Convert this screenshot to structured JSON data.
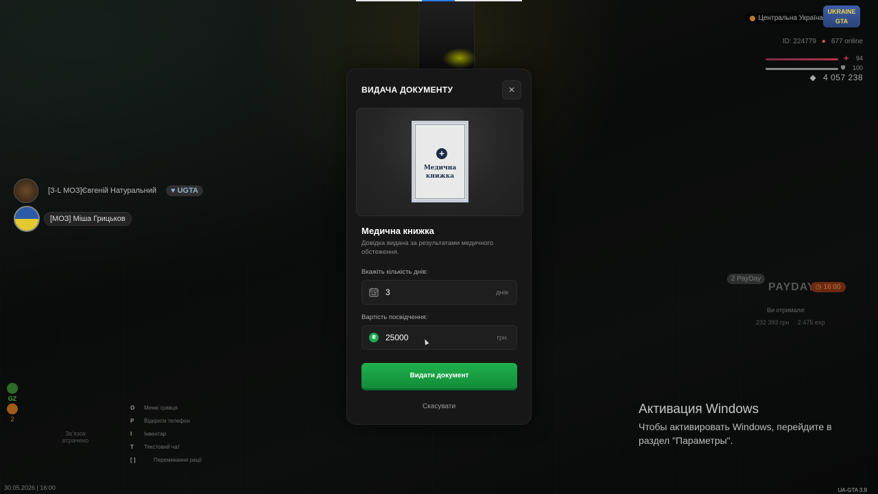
{
  "hud": {
    "region": "Центральна Україна",
    "logo": "UKRAINE GTA",
    "id_text": "ID: 224779",
    "online_text": "677 online",
    "hp": "94",
    "armor": "100",
    "money": "4 057 238"
  },
  "chat_players": [
    {
      "name": "[З-L МОЗ]Євгеній Натуральний",
      "tag": "UGTA"
    },
    {
      "name": "[МОЗ] Міша Грицьков"
    }
  ],
  "left_hud": {
    "gz": "GZ",
    "count": "2"
  },
  "keybinds": [
    {
      "key": "O",
      "label": "Меню гравця"
    },
    {
      "key": "P",
      "label": "Відкрити телефон"
    },
    {
      "key": "I",
      "label": "Інвентар"
    },
    {
      "key": "T",
      "label": "Текстовий чат"
    },
    {
      "key": "[ ]",
      "label": "Перемикання рації"
    }
  ],
  "zone_text": "Зв'язок втрачено",
  "datetime": "30.05.2026 | 16:00",
  "version": "UA-GTA 3.9",
  "payday": {
    "badge": "2 PayDay",
    "title": "PAYDAY",
    "time": "16:00",
    "received_label": "Ви отримали:",
    "money": "232 393 грн",
    "exp": "2 475 exp"
  },
  "windows_activation": {
    "heading": "Активация Windows",
    "text": "Чтобы активировать Windows, перейдите в раздел \"Параметры\"."
  },
  "modal": {
    "title": "ВИДАЧА ДОКУМЕНТУ",
    "close": "✕",
    "document_image_title": "Медична\nкнижка",
    "doc_name": "Медична книжка",
    "doc_description": "Довідка видана за результатами медичного обстеження.",
    "days_label": "Вкажіть кількість днів:",
    "days_value": "3",
    "days_unit": "днів",
    "cost_label": "Вартість посвідчення:",
    "cost_value": "25000",
    "cost_unit": "грн.",
    "submit_label": "Видати документ",
    "cancel_label": "Скасувати"
  },
  "colors": {
    "primary_button": "#1fb24d",
    "modal_bg": "#171717",
    "coin": "#1da851"
  }
}
